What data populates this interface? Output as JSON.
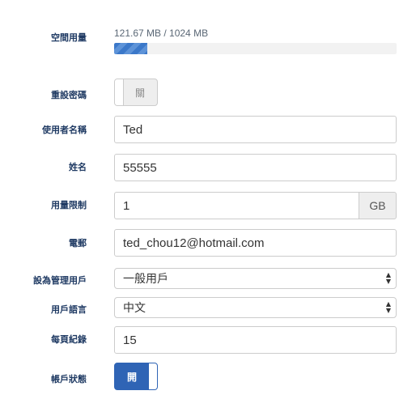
{
  "usage": {
    "label": "空間用量",
    "text": "121.67 MB / 1024 MB",
    "fraction": 0.1188
  },
  "reset_password": {
    "label": "重設密碼",
    "toggle_text": "關",
    "state": "off"
  },
  "username": {
    "label": "使用者名稱",
    "value": "Ted"
  },
  "full_name": {
    "label": "姓名",
    "value": "55555"
  },
  "quota": {
    "label": "用量限制",
    "value": "1",
    "unit": "GB"
  },
  "email": {
    "label": "電郵",
    "value": "ted_chou12@hotmail.com"
  },
  "admin": {
    "label": "設為管理用戶",
    "selected": "一般用戶"
  },
  "language": {
    "label": "用戶語言",
    "selected": "中文"
  },
  "per_page": {
    "label": "每頁紀錄",
    "value": "15"
  },
  "account_status": {
    "label": "帳戶狀態",
    "toggle_text": "開",
    "state": "on"
  },
  "colors": {
    "accent": "#2f64b5",
    "label": "#1f3a63"
  }
}
